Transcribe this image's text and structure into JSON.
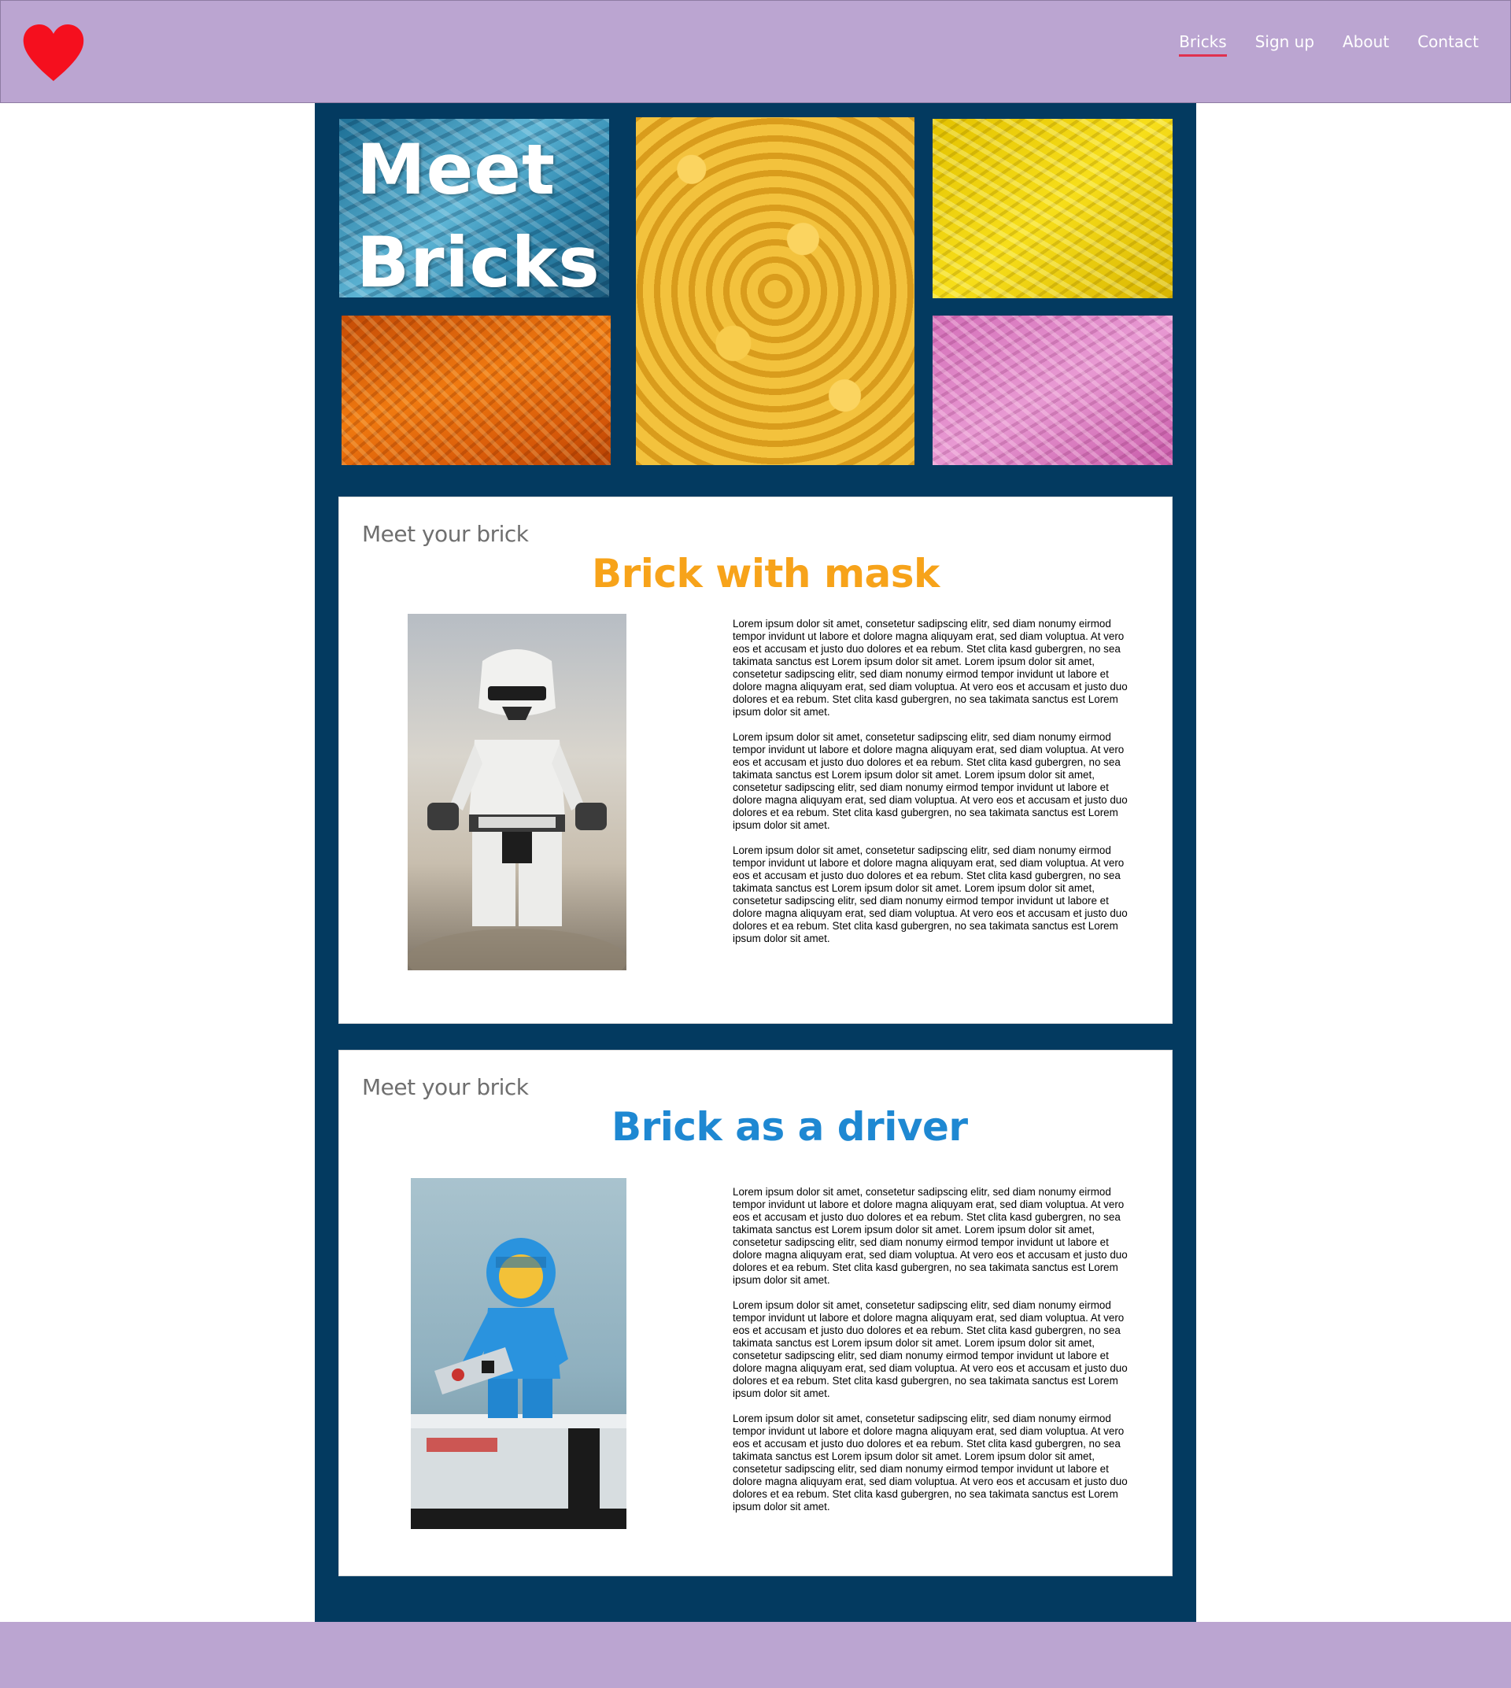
{
  "header": {
    "nav": [
      {
        "label": "Bricks",
        "active": true
      },
      {
        "label": "Sign up",
        "active": false
      },
      {
        "label": "About",
        "active": false
      },
      {
        "label": "Contact",
        "active": false
      }
    ],
    "logo_icon": "heart-icon",
    "logo_color": "#f50f1e",
    "background": "#bba5d1"
  },
  "hero": {
    "title_line1": "Meet",
    "title_line2": "Bricks"
  },
  "cards": [
    {
      "kicker": "Meet your brick",
      "title": "Brick with mask",
      "title_color": "#f7a31a",
      "paragraphs": [
        "Lorem ipsum dolor sit amet, consetetur sadipscing elitr, sed diam nonumy eirmod tempor invidunt ut labore et dolore magna aliquyam erat, sed diam voluptua. At vero eos et accusam et justo duo dolores et ea rebum. Stet clita kasd gubergren, no sea takimata sanctus est Lorem ipsum dolor sit amet. Lorem ipsum dolor sit amet, consetetur sadipscing elitr, sed diam nonumy eirmod tempor invidunt ut labore et dolore magna aliquyam erat, sed diam voluptua. At vero eos et accusam et justo duo dolores et ea rebum. Stet clita kasd gubergren, no sea takimata sanctus est Lorem ipsum dolor sit amet.",
        "Lorem ipsum dolor sit amet, consetetur sadipscing elitr, sed diam nonumy eirmod tempor invidunt ut labore et dolore magna aliquyam erat, sed diam voluptua. At vero eos et accusam et justo duo dolores et ea rebum. Stet clita kasd gubergren, no sea takimata sanctus est Lorem ipsum dolor sit amet. Lorem ipsum dolor sit amet, consetetur sadipscing elitr, sed diam nonumy eirmod tempor invidunt ut labore et dolore magna aliquyam erat, sed diam voluptua. At vero eos et accusam et justo duo dolores et ea rebum. Stet clita kasd gubergren, no sea takimata sanctus est Lorem ipsum dolor sit amet.",
        "Lorem ipsum dolor sit amet, consetetur sadipscing elitr, sed diam nonumy eirmod tempor invidunt ut labore et dolore magna aliquyam erat, sed diam voluptua. At vero eos et accusam et justo duo dolores et ea rebum. Stet clita kasd gubergren, no sea takimata sanctus est Lorem ipsum dolor sit amet. Lorem ipsum dolor sit amet, consetetur sadipscing elitr, sed diam nonumy eirmod tempor invidunt ut labore et dolore magna aliquyam erat, sed diam voluptua. At vero eos et accusam et justo duo dolores et ea rebum. Stet clita kasd gubergren, no sea takimata sanctus est Lorem ipsum dolor sit amet."
      ]
    },
    {
      "kicker": "Meet your brick",
      "title": "Brick as a driver",
      "title_color": "#1e88d2",
      "paragraphs": [
        "Lorem ipsum dolor sit amet, consetetur sadipscing elitr, sed diam nonumy eirmod tempor invidunt ut labore et dolore magna aliquyam erat, sed diam voluptua. At vero eos et accusam et justo duo dolores et ea rebum. Stet clita kasd gubergren, no sea takimata sanctus est Lorem ipsum dolor sit amet. Lorem ipsum dolor sit amet, consetetur sadipscing elitr, sed diam nonumy eirmod tempor invidunt ut labore et dolore magna aliquyam erat, sed diam voluptua. At vero eos et accusam et justo duo dolores et ea rebum. Stet clita kasd gubergren, no sea takimata sanctus est Lorem ipsum dolor sit amet.",
        "Lorem ipsum dolor sit amet, consetetur sadipscing elitr, sed diam nonumy eirmod tempor invidunt ut labore et dolore magna aliquyam erat, sed diam voluptua. At vero eos et accusam et justo duo dolores et ea rebum. Stet clita kasd gubergren, no sea takimata sanctus est Lorem ipsum dolor sit amet. Lorem ipsum dolor sit amet, consetetur sadipscing elitr, sed diam nonumy eirmod tempor invidunt ut labore et dolore magna aliquyam erat, sed diam voluptua. At vero eos et accusam et justo duo dolores et ea rebum. Stet clita kasd gubergren, no sea takimata sanctus est Lorem ipsum dolor sit amet.",
        "Lorem ipsum dolor sit amet, consetetur sadipscing elitr, sed diam nonumy eirmod tempor invidunt ut labore et dolore magna aliquyam erat, sed diam voluptua. At vero eos et accusam et justo duo dolores et ea rebum. Stet clita kasd gubergren, no sea takimata sanctus est Lorem ipsum dolor sit amet. Lorem ipsum dolor sit amet, consetetur sadipscing elitr, sed diam nonumy eirmod tempor invidunt ut labore et dolore magna aliquyam erat, sed diam voluptua. At vero eos et accusam et justo duo dolores et ea rebum. Stet clita kasd gubergren, no sea takimata sanctus est Lorem ipsum dolor sit amet."
      ]
    }
  ],
  "colors": {
    "main_background": "#033a60",
    "footer": "#bba5d1",
    "nav_underline": "#e0314f"
  }
}
